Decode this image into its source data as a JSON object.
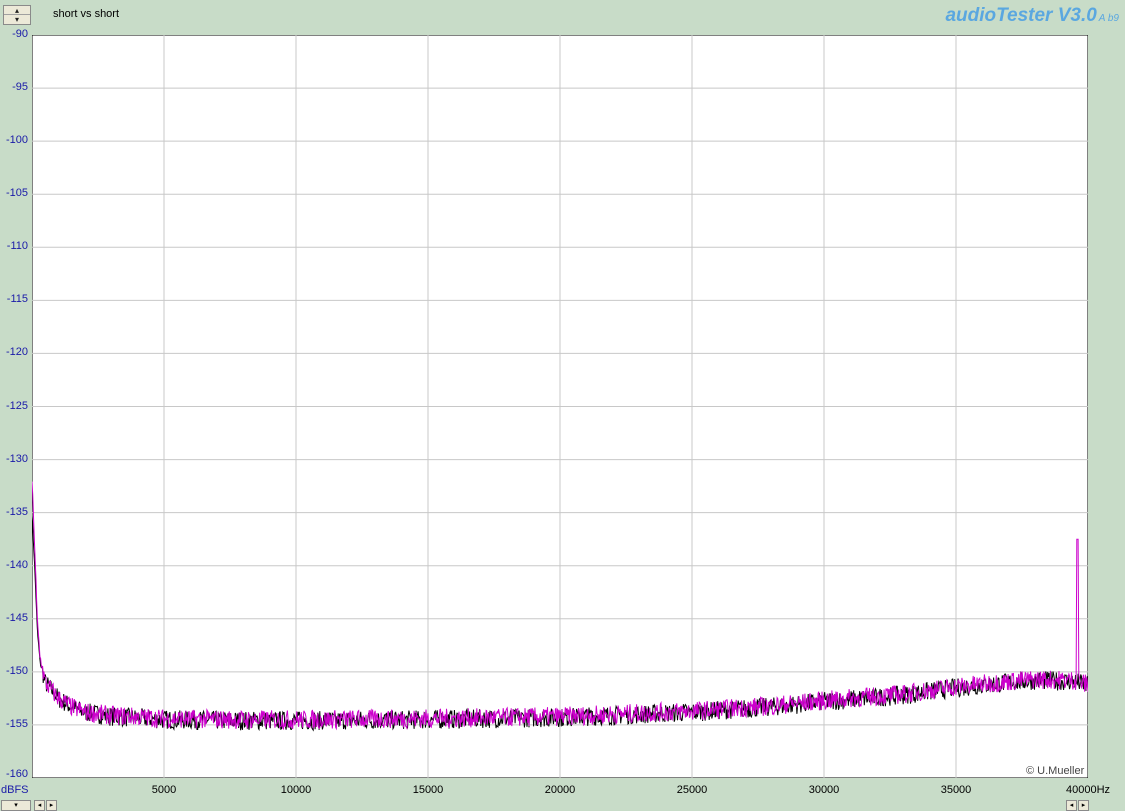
{
  "header": {
    "title": "short vs short",
    "brand": "audioTester V3.0",
    "brand_version": "A b9"
  },
  "footer": {
    "copyright": "© U.Mueller"
  },
  "colors": {
    "series_black": "#000000",
    "series_magenta": "#cc00cc",
    "grid": "#c8c8c8",
    "plot_bg": "#ffffff",
    "axis_text": "#1a1aa8"
  },
  "chart_data": {
    "type": "line",
    "title": "short vs short",
    "xlabel": "Hz",
    "ylabel": "dBFS",
    "xlim": [
      0,
      40000
    ],
    "ylim": [
      -160,
      -90
    ],
    "x_ticks": [
      5000,
      10000,
      15000,
      20000,
      25000,
      30000,
      35000,
      40000
    ],
    "x_tick_labels": [
      "5000",
      "10000",
      "15000",
      "20000",
      "25000",
      "30000",
      "35000",
      "40000Hz"
    ],
    "y_ticks": [
      -90,
      -95,
      -100,
      -105,
      -110,
      -115,
      -120,
      -125,
      -130,
      -135,
      -140,
      -145,
      -150,
      -155,
      -160
    ],
    "grid": true,
    "series": [
      {
        "color": "#000000",
        "x": [
          0,
          100,
          200,
          300,
          500,
          1000,
          1500,
          2000,
          3000,
          5000,
          8000,
          10000,
          15000,
          20000,
          25000,
          28000,
          30000,
          33000,
          35000,
          37000,
          38000,
          39500,
          40000
        ],
        "y": [
          -135,
          -140,
          -146,
          -149,
          -151,
          -152.5,
          -153.3,
          -153.8,
          -154.2,
          -154.5,
          -154.6,
          -154.6,
          -154.5,
          -154.3,
          -153.8,
          -153.3,
          -152.8,
          -152.2,
          -151.5,
          -151.0,
          -150.8,
          -150.9,
          -151.3
        ]
      },
      {
        "color": "#cc00cc",
        "x": [
          0,
          100,
          200,
          300,
          500,
          1000,
          1500,
          2000,
          3000,
          5000,
          8000,
          10000,
          15000,
          20000,
          25000,
          28000,
          30000,
          33000,
          35000,
          37000,
          38000,
          39500,
          40000
        ],
        "y": [
          -132,
          -138,
          -145,
          -148.5,
          -151,
          -152.5,
          -153.3,
          -153.8,
          -154.1,
          -154.4,
          -154.5,
          -154.5,
          -154.4,
          -154.2,
          -153.7,
          -153.2,
          -152.7,
          -152.1,
          -151.4,
          -150.9,
          -150.7,
          -150.8,
          -151.2
        ],
        "peaks": [
          {
            "x": 39600,
            "y": -137.5
          }
        ]
      }
    ]
  }
}
